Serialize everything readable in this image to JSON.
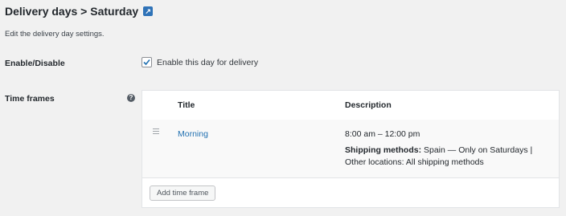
{
  "header": {
    "title": "Delivery days > Saturday",
    "link_icon_label": "↗"
  },
  "description": "Edit the delivery day settings.",
  "enable": {
    "label": "Enable/Disable",
    "checkbox_label": "Enable this day for delivery",
    "checked": true
  },
  "time_frames": {
    "label": "Time frames",
    "help_icon": "?",
    "columns": {
      "title": "Title",
      "description": "Description"
    },
    "rows": [
      {
        "title": "Morning",
        "time": "8:00 am – 12:00 pm",
        "shipping_label": "Shipping methods:",
        "shipping_value": "Spain — Only on Saturdays | Other locations: All shipping methods"
      }
    ],
    "add_button": "Add time frame"
  },
  "colors": {
    "link": "#2271b1",
    "accent": "#2f73b8",
    "background": "#f1f1f1"
  }
}
